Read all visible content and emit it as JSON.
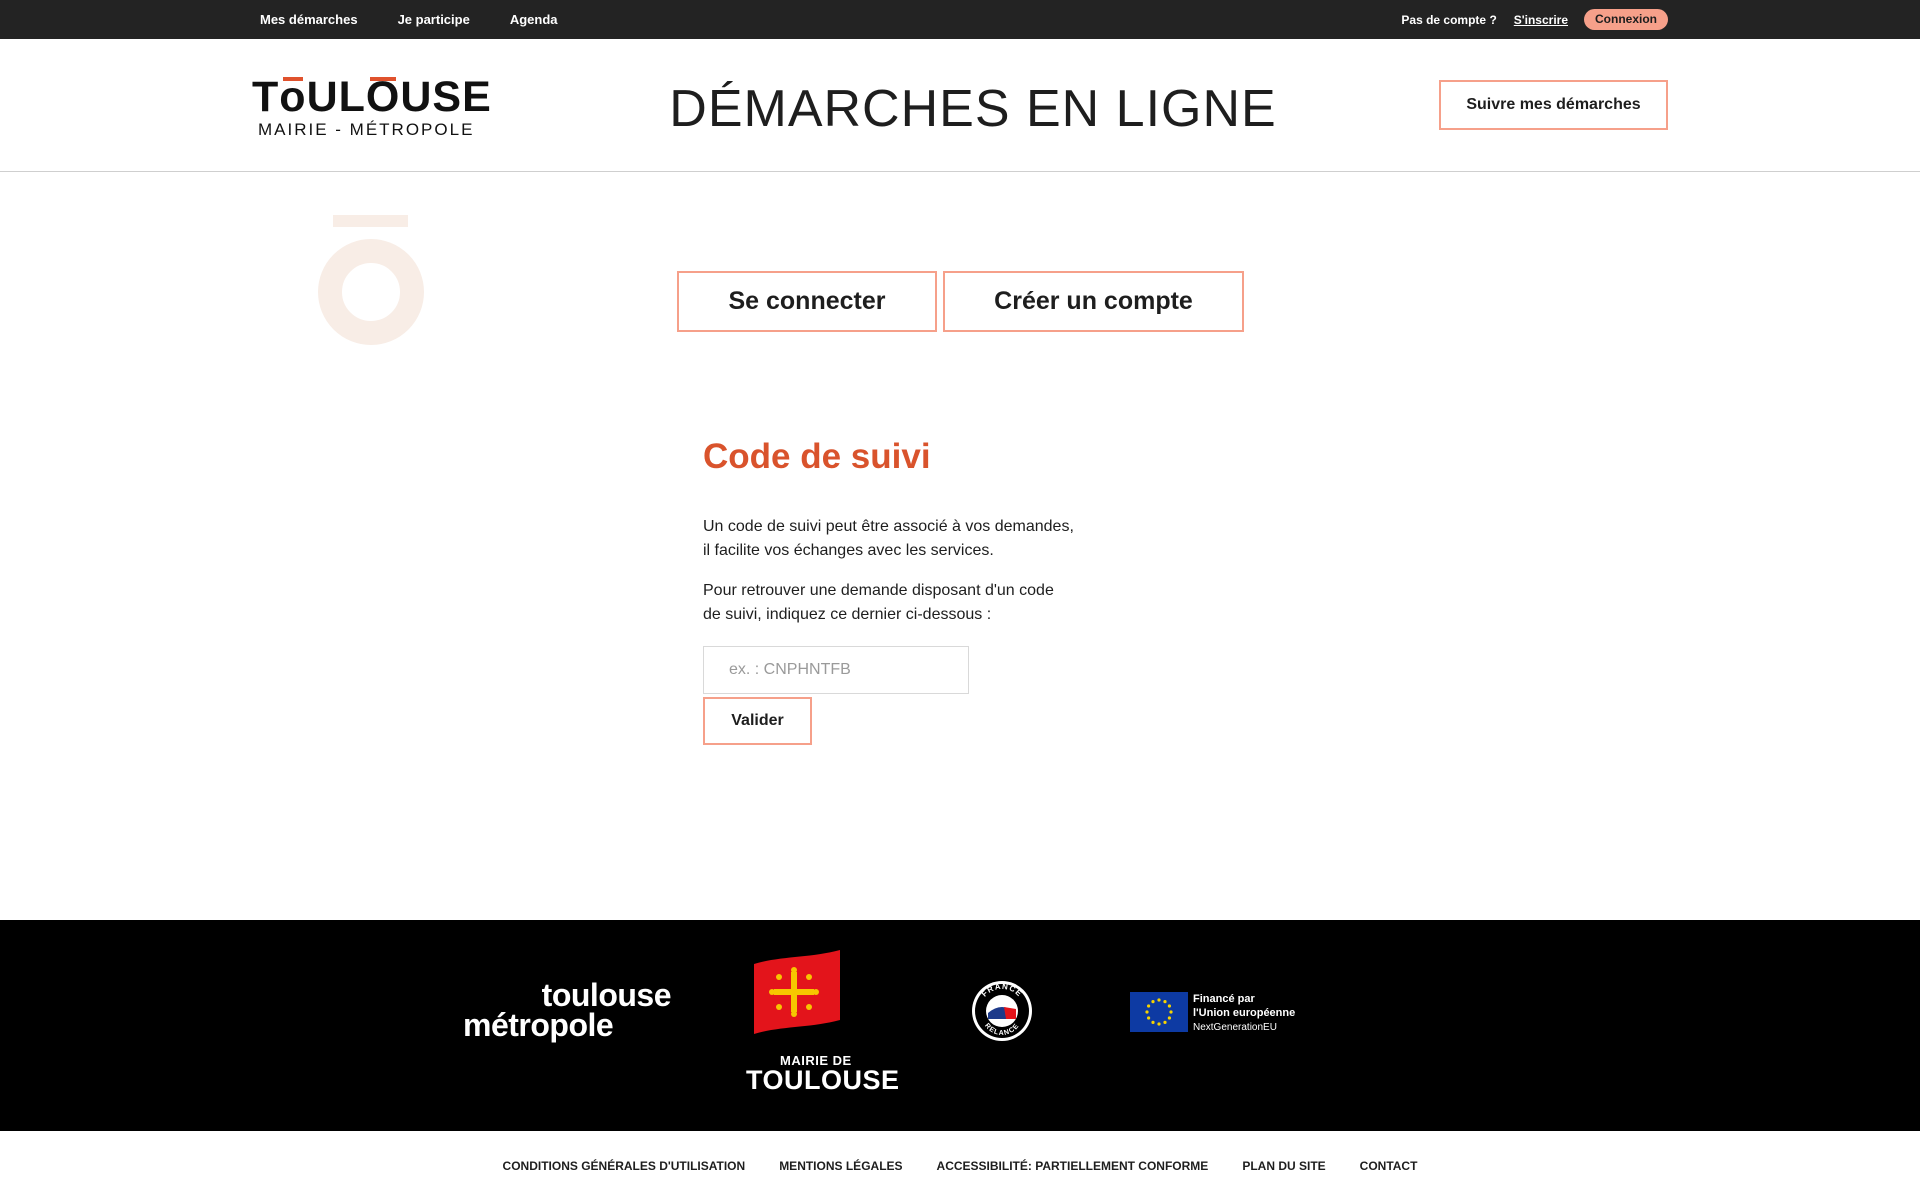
{
  "topbar": {
    "nav": [
      "Mes démarches",
      "Je participe",
      "Agenda"
    ],
    "no_account": "Pas de compte ?",
    "signup": "S'inscrire",
    "login": "Connexion"
  },
  "header": {
    "logo_word_a": "T",
    "logo_word_o": "o",
    "logo_word_b": "UL",
    "logo_word_o2": "O",
    "logo_word_c": "USE",
    "logo_sub": "MAIRIE - MÉTROPOLE",
    "title": "DÉMARCHES EN LIGNE",
    "follow_button": "Suivre mes démarches"
  },
  "auth": {
    "login_button": "Se connecter",
    "create_button": "Créer un compte"
  },
  "tracking": {
    "title": "Code de suivi",
    "p1_line1": "Un code de suivi peut être associé à vos demandes,",
    "p1_line2": "il facilite vos échanges avec les services.",
    "p2_line1": "Pour retrouver une demande disposant d'un code",
    "p2_line2": "de suivi, indiquez ce dernier ci-dessous :",
    "input_placeholder": "ex. : CNPHNTFB",
    "input_value": "",
    "submit": "Valider"
  },
  "footer": {
    "metro_line1": "toulouse",
    "metro_line2": "métropole",
    "mairie_line1": "MAIRIE DE",
    "mairie_line2": "TOULOUSE",
    "relance_top": "FRANCE",
    "relance_bottom": "RELANCE",
    "eu_line1": "Financé par",
    "eu_line2": "l'Union européenne",
    "eu_line3": "NextGenerationEU"
  },
  "bottom_links": [
    "CONDITIONS GÉNÉRALES D'UTILISATION",
    "MENTIONS LÉGALES",
    "ACCESSIBILITÉ: PARTIELLEMENT CONFORME",
    "PLAN DU SITE",
    "CONTACT"
  ],
  "colors": {
    "accent": "#f6a08a",
    "title_orange": "#d9532c",
    "dark_bar": "#232323",
    "deco": "#f8ede6"
  }
}
